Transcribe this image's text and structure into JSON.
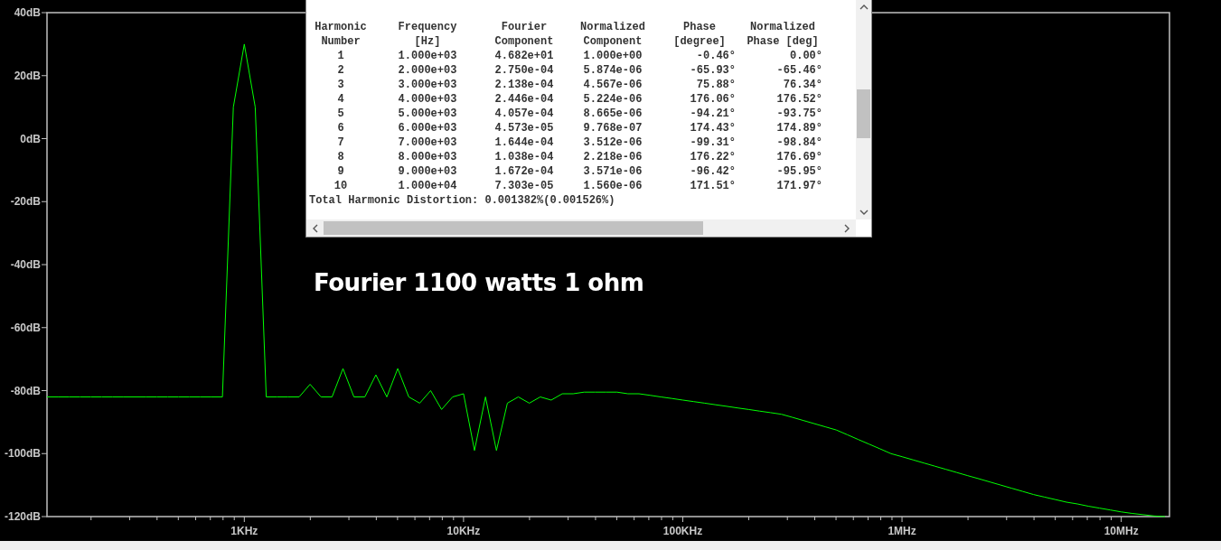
{
  "plot": {
    "chart_data": {
      "type": "line",
      "ylim": [
        -120,
        40
      ],
      "yticks": [
        {
          "value": 40,
          "label": "40dB"
        },
        {
          "value": 20,
          "label": "20dB"
        },
        {
          "value": 0,
          "label": "0dB"
        },
        {
          "value": -20,
          "label": "-20dB"
        },
        {
          "value": -40,
          "label": "-40dB"
        },
        {
          "value": -60,
          "label": "-60dB"
        },
        {
          "value": -80,
          "label": "-80dB"
        },
        {
          "value": -100,
          "label": "-100dB"
        },
        {
          "value": -120,
          "label": "-120dB"
        }
      ],
      "categories": [
        null,
        null,
        null,
        null,
        null,
        null,
        null,
        null,
        null,
        null,
        null,
        null,
        null,
        null,
        null,
        null,
        null,
        null,
        "1KHz",
        null,
        null,
        null,
        null,
        null,
        null,
        null,
        null,
        null,
        null,
        null,
        null,
        null,
        null,
        null,
        null,
        null,
        null,
        null,
        "10KHz",
        null,
        null,
        null,
        null,
        null,
        null,
        null,
        null,
        null,
        null,
        null,
        null,
        null,
        null,
        null,
        null,
        null,
        null,
        null,
        "100KHz",
        null,
        null,
        null,
        null,
        null,
        null,
        null,
        null,
        null,
        null,
        null,
        null,
        null,
        null,
        null,
        null,
        null,
        null,
        null,
        "1MHz",
        null,
        null,
        null,
        null,
        null,
        null,
        null,
        null,
        null,
        null,
        null,
        null,
        null,
        null,
        null,
        null,
        null,
        null,
        null,
        "10MHz",
        null,
        null,
        null,
        null
      ],
      "series": [
        {
          "color": "#00ff00",
          "values": [
            -82,
            -82,
            -82,
            -82,
            -82,
            -82,
            -82,
            -82,
            -82,
            -82,
            -82,
            -82,
            -82,
            -82,
            -82,
            -82,
            -82,
            10,
            30,
            10,
            -82,
            -82,
            -82,
            -82,
            -78,
            -82,
            -82,
            -73,
            -82,
            -82,
            -75,
            -82,
            -73,
            -82,
            -84,
            -80,
            -86,
            -82,
            -81,
            -99,
            -82,
            -99,
            -84,
            -82,
            -84,
            -82,
            -83,
            -81,
            -81,
            -80.5,
            -80.5,
            -80.5,
            -80.5,
            -81,
            -81,
            -81.5,
            -82,
            -82.5,
            -83,
            -83.5,
            -84,
            -84.5,
            -85,
            -85.5,
            -86,
            -86.5,
            -87,
            -87.5,
            -88.5,
            -89.5,
            -90.5,
            -91.5,
            -92.5,
            -94,
            -95.5,
            -97,
            -98.5,
            -100,
            -101,
            -102,
            -103,
            -104,
            -105,
            -106,
            -107,
            -108,
            -109,
            -110,
            -111,
            -112,
            -113,
            -113.8,
            -114.6,
            -115.4,
            -116,
            -116.7,
            -117.3,
            -117.9,
            -118.5,
            -119,
            -119.4,
            -119.8,
            -120
          ]
        }
      ]
    }
  },
  "caption": "Fourier 1100 watts 1 ohm",
  "fourier_window": {
    "columns": [
      {
        "header": [
          "Harmonic",
          "Number"
        ]
      },
      {
        "header": [
          "Frequency",
          "[Hz]"
        ]
      },
      {
        "header": [
          "Fourier",
          "Component"
        ]
      },
      {
        "header": [
          "Normalized",
          "Component"
        ]
      },
      {
        "header": [
          "Phase",
          "[degree]"
        ]
      },
      {
        "header": [
          "Normalized",
          "Phase [deg]"
        ]
      }
    ],
    "rows": [
      [
        "1",
        "1.000e+03",
        "4.682e+01",
        "1.000e+00",
        "-0.46°",
        "0.00°"
      ],
      [
        "2",
        "2.000e+03",
        "2.750e-04",
        "5.874e-06",
        "-65.93°",
        "-65.46°"
      ],
      [
        "3",
        "3.000e+03",
        "2.138e-04",
        "4.567e-06",
        "75.88°",
        "76.34°"
      ],
      [
        "4",
        "4.000e+03",
        "2.446e-04",
        "5.224e-06",
        "176.06°",
        "176.52°"
      ],
      [
        "5",
        "5.000e+03",
        "4.057e-04",
        "8.665e-06",
        "-94.21°",
        "-93.75°"
      ],
      [
        "6",
        "6.000e+03",
        "4.573e-05",
        "9.768e-07",
        "174.43°",
        "174.89°"
      ],
      [
        "7",
        "7.000e+03",
        "1.644e-04",
        "3.512e-06",
        "-99.31°",
        "-98.84°"
      ],
      [
        "8",
        "8.000e+03",
        "1.038e-04",
        "2.218e-06",
        "176.22°",
        "176.69°"
      ],
      [
        "9",
        "9.000e+03",
        "1.672e-04",
        "3.571e-06",
        "-96.42°",
        "-95.95°"
      ],
      [
        "10",
        "1.000e+04",
        "7.303e-05",
        "1.560e-06",
        "171.51°",
        "171.97°"
      ]
    ],
    "thd": "Total Harmonic Distortion: 0.001382%(0.001526%)"
  }
}
